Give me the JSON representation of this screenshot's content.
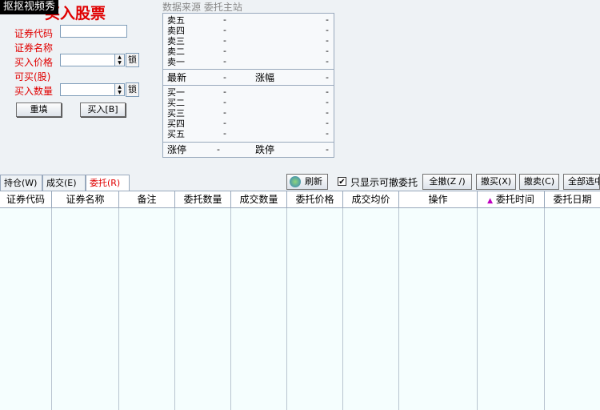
{
  "watermark": "抠抠视频秀",
  "title": "买入股票",
  "form": {
    "code_label": "证券代码",
    "name_label": "证券名称",
    "price_label": "买入价格",
    "avail_label": "可买(股)",
    "qty_label": "买入数量",
    "lock_label": "锁",
    "reset_label": "重填",
    "buy_label": "买入[B]"
  },
  "quote": {
    "header": "数据来源  委托主站",
    "sell": [
      "卖五",
      "卖四",
      "卖三",
      "卖二",
      "卖一"
    ],
    "buy": [
      "买一",
      "买二",
      "买三",
      "买四",
      "买五"
    ],
    "latest_label": "最新",
    "change_label": "涨幅",
    "up_limit_label": "涨停",
    "down_limit_label": "跌停",
    "empty": "-"
  },
  "tabs": [
    "持仓(W)",
    "成交(E)",
    "委托(R)"
  ],
  "toolbar": {
    "refresh": "刷新",
    "only_cancelable_checked": "✔",
    "only_cancelable": "只显示可撤委托",
    "cancel_all": "全撤(Z /)",
    "cancel_buy": "撤买(X)",
    "cancel_sell": "撤卖(C)",
    "select_all": "全部选中"
  },
  "table": {
    "columns": [
      "证券代码",
      "证券名称",
      "备注",
      "委托数量",
      "成交数量",
      "委托价格",
      "成交均价",
      "操作",
      "委托时间",
      "委托日期"
    ],
    "sort_indicator": "▲",
    "rows": []
  }
}
